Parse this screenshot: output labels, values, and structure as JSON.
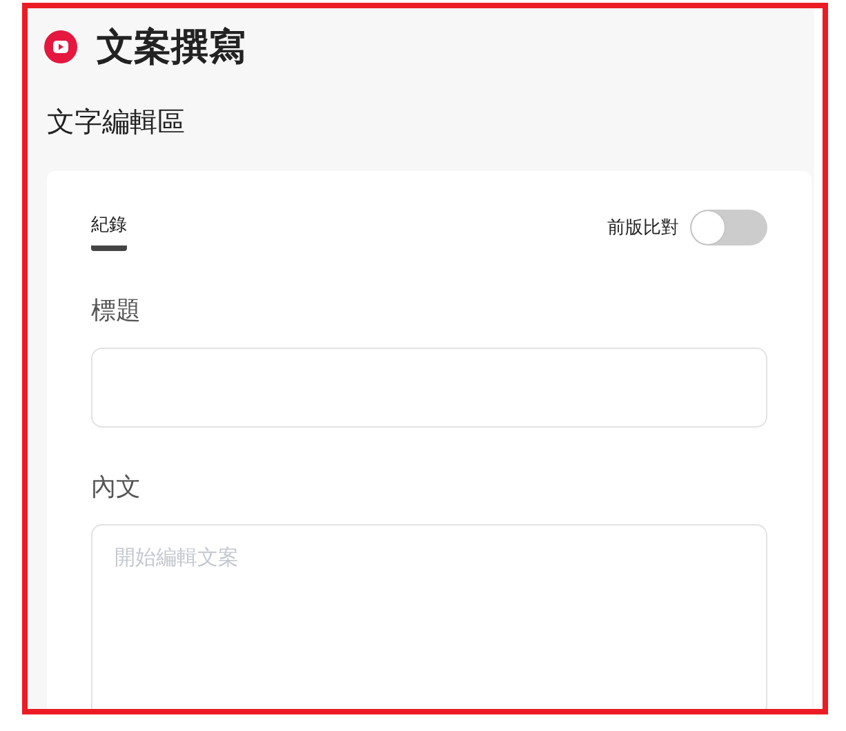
{
  "header": {
    "title": "文案撰寫"
  },
  "section_title": "文字編輯區",
  "tabs": [
    {
      "label": "紀錄",
      "selected": true
    }
  ],
  "compare_toggle": {
    "label": "前版比對",
    "on": false
  },
  "fields": [
    {
      "kind": "input",
      "label": "標題"
    },
    {
      "kind": "textarea",
      "label": "內文",
      "placeholder": "開始編輯文案"
    }
  ]
}
